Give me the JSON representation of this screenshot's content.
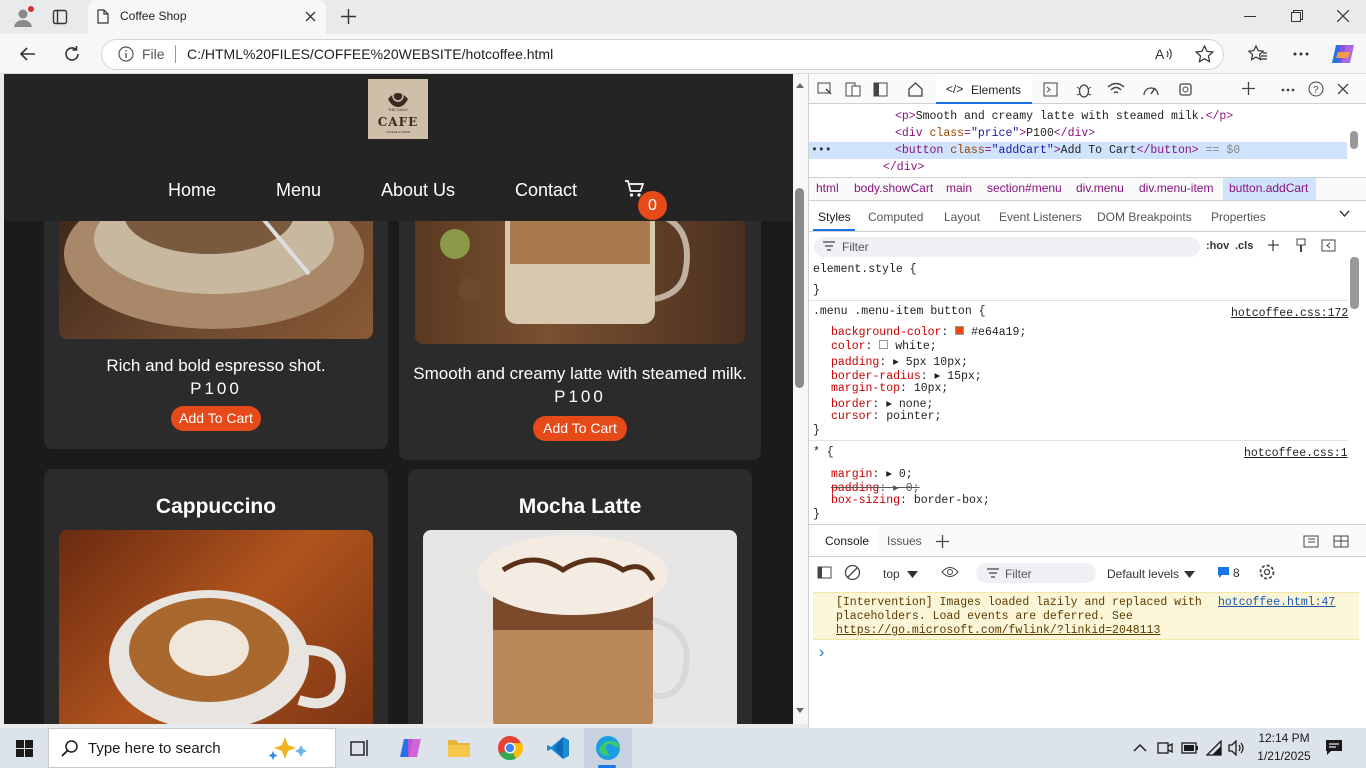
{
  "browser": {
    "tab_title": "Coffee Shop",
    "address_prefix": "File",
    "address_url": "C:/HTML%20FILES/COFFEE%20WEBSITE/hotcoffee.html"
  },
  "site": {
    "logo_top": "THE DAILY",
    "logo_text": "CAFE",
    "logo_bottom": "COFFEE & MORE",
    "nav": [
      "Home",
      "Menu",
      "About Us",
      "Contact"
    ],
    "cart_count": "0",
    "cards": [
      {
        "title": "",
        "desc": "Rich and bold espresso shot.",
        "price": "P100",
        "button": "Add To Cart"
      },
      {
        "title": "",
        "desc": "Smooth and creamy latte with steamed milk.",
        "price": "P100",
        "button": "Add To Cart"
      },
      {
        "title": "Cappuccino"
      },
      {
        "title": "Mocha Latte"
      }
    ]
  },
  "devtools": {
    "tabs": {
      "elements": "Elements"
    },
    "dom": {
      "line1_text": "Smooth and creamy latte with steamed milk.",
      "line2_text": "P100",
      "line3_text": "Add To Cart",
      "selected_marker": "== $0"
    },
    "breadcrumbs": [
      "html",
      "body.showCart",
      "main",
      "section#menu",
      "div.menu",
      "div.menu-item",
      "button.addCart"
    ],
    "style_tabs": [
      "Styles",
      "Computed",
      "Layout",
      "Event Listeners",
      "DOM Breakpoints",
      "Properties"
    ],
    "filter_placeholder": "Filter",
    "hov": ":hov",
    "cls": ".cls",
    "element_style": "element.style {",
    "rule1": {
      "selector": ".menu .menu-item button {",
      "source": "hotcoffee.css:172",
      "props": [
        {
          "name": "background-color",
          "value": "#e64a19"
        },
        {
          "name": "color",
          "value": "white;"
        },
        {
          "name": "padding",
          "value": "5px 10px;"
        },
        {
          "name": "border-radius",
          "value": "15px;"
        },
        {
          "name": "margin-top",
          "value": "10px;"
        },
        {
          "name": "border",
          "value": "none;"
        },
        {
          "name": "cursor",
          "value": "pointer;"
        }
      ],
      "swatch_color": "#e64a19"
    },
    "rule2": {
      "selector": "* {",
      "source": "hotcoffee.css:1",
      "props": [
        {
          "name": "margin",
          "value": "0;"
        },
        {
          "name": "padding",
          "value": "0;"
        },
        {
          "name": "box-sizing",
          "value": "border-box;"
        }
      ]
    },
    "console_tabs": [
      "Console",
      "Issues"
    ],
    "console_context": "top",
    "console_filter": "Filter",
    "default_levels": "Default levels",
    "issue_count": "8",
    "message": {
      "line1": "[Intervention] Images loaded lazily and replaced with",
      "line2": "placeholders. Load events are deferred. See",
      "link": "https://go.microsoft.com/fwlink/?linkid=2048113",
      "source": "hotcoffee.html:47"
    },
    "prompt": "›"
  },
  "taskbar": {
    "search_placeholder": "Type here to search",
    "time": "12:14 PM",
    "date": "1/21/2025"
  },
  "colors": {
    "accent": "#e64a19",
    "page_bg": "#1b1b1b",
    "card_bg": "#2b2b2b",
    "devtools_selected": "#cfe3fc"
  }
}
